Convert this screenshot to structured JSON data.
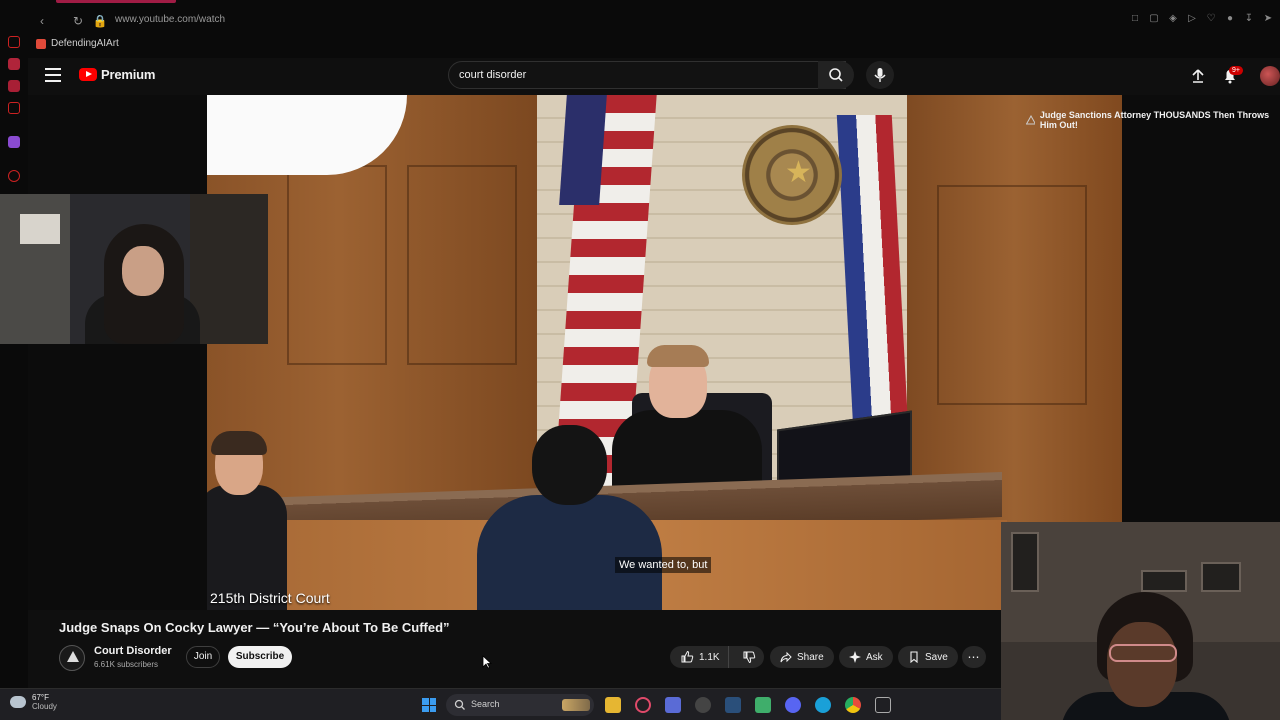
{
  "browser": {
    "url": "www.youtube.com/watch",
    "bookmark_label": "DefendingAIArt"
  },
  "header": {
    "logo_text": "Premium",
    "search_query": "court disorder",
    "notification_count": "9+"
  },
  "video": {
    "subtitle": "We wanted to, but",
    "court_label": "215th  District Court"
  },
  "up_next": {
    "title": "Judge Sanctions Attorney THOUSANDS Then Throws Him Out!"
  },
  "info": {
    "title": "Judge Snaps On Cocky Lawyer — “You’re About To Be Cuffed”",
    "channel_name": "Court Disorder",
    "subscriber_count": "6.61K subscribers",
    "join_label": "Join",
    "subscribe_label": "Subscribe",
    "like_count": "1.1K",
    "share_label": "Share",
    "ask_label": "Ask",
    "save_label": "Save"
  },
  "taskbar": {
    "temperature": "67°F",
    "weather_desc": "Cloudy",
    "search_label": "Search"
  },
  "colors": {
    "youtube_red": "#ff0000",
    "background": "#0f0f0f",
    "pill": "#272727"
  }
}
